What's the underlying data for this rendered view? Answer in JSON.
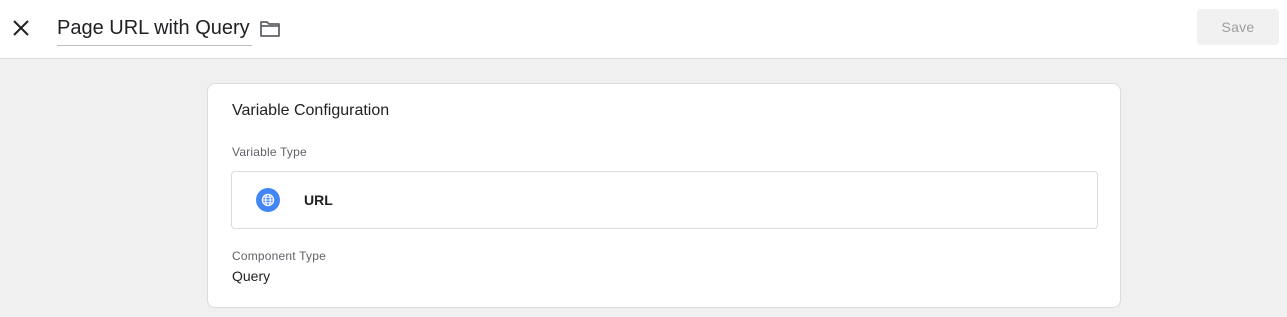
{
  "header": {
    "title": "Page URL with Query",
    "save_label": "Save",
    "close_icon": "close-icon",
    "folder_icon": "folder-icon"
  },
  "card": {
    "title": "Variable Configuration",
    "variable_type_label": "Variable Type",
    "variable_type": {
      "name": "URL",
      "icon": "globe-icon",
      "icon_color": "#4285f4"
    },
    "component_type_label": "Component Type",
    "component_type_value": "Query"
  }
}
